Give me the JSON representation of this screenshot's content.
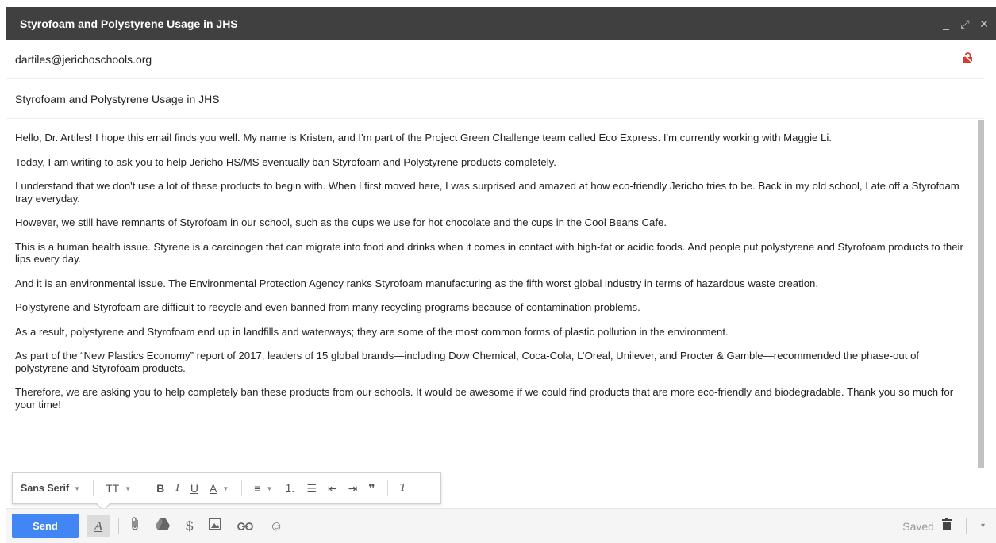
{
  "window": {
    "title": "Styrofoam and Polystyrene Usage in JHS",
    "minimize_glyph": "_",
    "popout_glyph": "⤢",
    "close_glyph": "✕"
  },
  "to": {
    "value": "dartiles@jerichoschools.org",
    "lock_icon": "lock-icon"
  },
  "subject": {
    "value": "Styrofoam and Polystyrene Usage in JHS"
  },
  "body": {
    "paragraphs": [
      "Hello, Dr. Artiles! I hope this email finds you well. My name is Kristen, and I'm part of the Project Green Challenge team called Eco Express. I'm currently working with Maggie Li.",
      "Today, I am writing to ask you to help Jericho HS/MS eventually ban Styrofoam and Polystyrene products completely.",
      "I understand that we don't use a lot of these products to begin with. When I first moved here, I was surprised and amazed at how eco-friendly Jericho tries to be. Back in my old school, I ate off a Styrofoam tray everyday.",
      "However, we still have remnants of Styrofoam in our school, such as the cups we use for hot chocolate and the cups in the Cool Beans Cafe.",
      "This is a human health issue. Styrene is a carcinogen that can migrate into food and drinks when it comes in contact with high-fat or acidic foods. And people put polystyrene and Styrofoam products to their lips every day.",
      "And it is an environmental issue. The Environmental Protection Agency ranks Styrofoam manufacturing as the fifth worst global industry in terms of hazardous waste creation.",
      "Polystyrene and Styrofoam are difficult to recycle and even banned from many recycling programs because of contamination problems.",
      "As a result, polystyrene and Styrofoam end up in landfills and waterways; they are some of the most common forms of plastic pollution in the environment.",
      "As part of the “New Plastics Economy” report of 2017, leaders of 15 global brands—including Dow Chemical, Coca-Cola, L’Oreal, Unilever, and Procter & Gamble—recommended the phase-out of polystyrene and Styrofoam products.",
      "Therefore, we are asking you to help completely ban these products from our schools. It would be awesome if we could find products that are more eco-friendly and biodegradable. Thank you so much for your time!"
    ]
  },
  "format_toolbar": {
    "font": "Sans Serif",
    "size_glyph": "TT",
    "bold_glyph": "B",
    "italic_glyph": "I",
    "underline_glyph": "U",
    "text_color_glyph": "A",
    "align_glyph": "≡",
    "numbered_list_glyph": "⒈",
    "bulleted_list_glyph": "☰",
    "indent_less_glyph": "⇤",
    "indent_more_glyph": "⇥",
    "quote_glyph": "❞",
    "remove_format_glyph": "T"
  },
  "bottom_bar": {
    "send_label": "Send",
    "formatting_glyph": "A",
    "attach_glyph": "📎",
    "drive_glyph": "▲",
    "money_glyph": "$",
    "photo_glyph": "▣",
    "link_glyph": "⊂⊃",
    "emoji_glyph": "☺",
    "saved_label": "Saved",
    "trash_glyph": "🗑",
    "more_glyph": "▾"
  },
  "colors": {
    "titlebar": "#404040",
    "send_button": "#4285f4",
    "lock_icon": "#d23f31"
  }
}
